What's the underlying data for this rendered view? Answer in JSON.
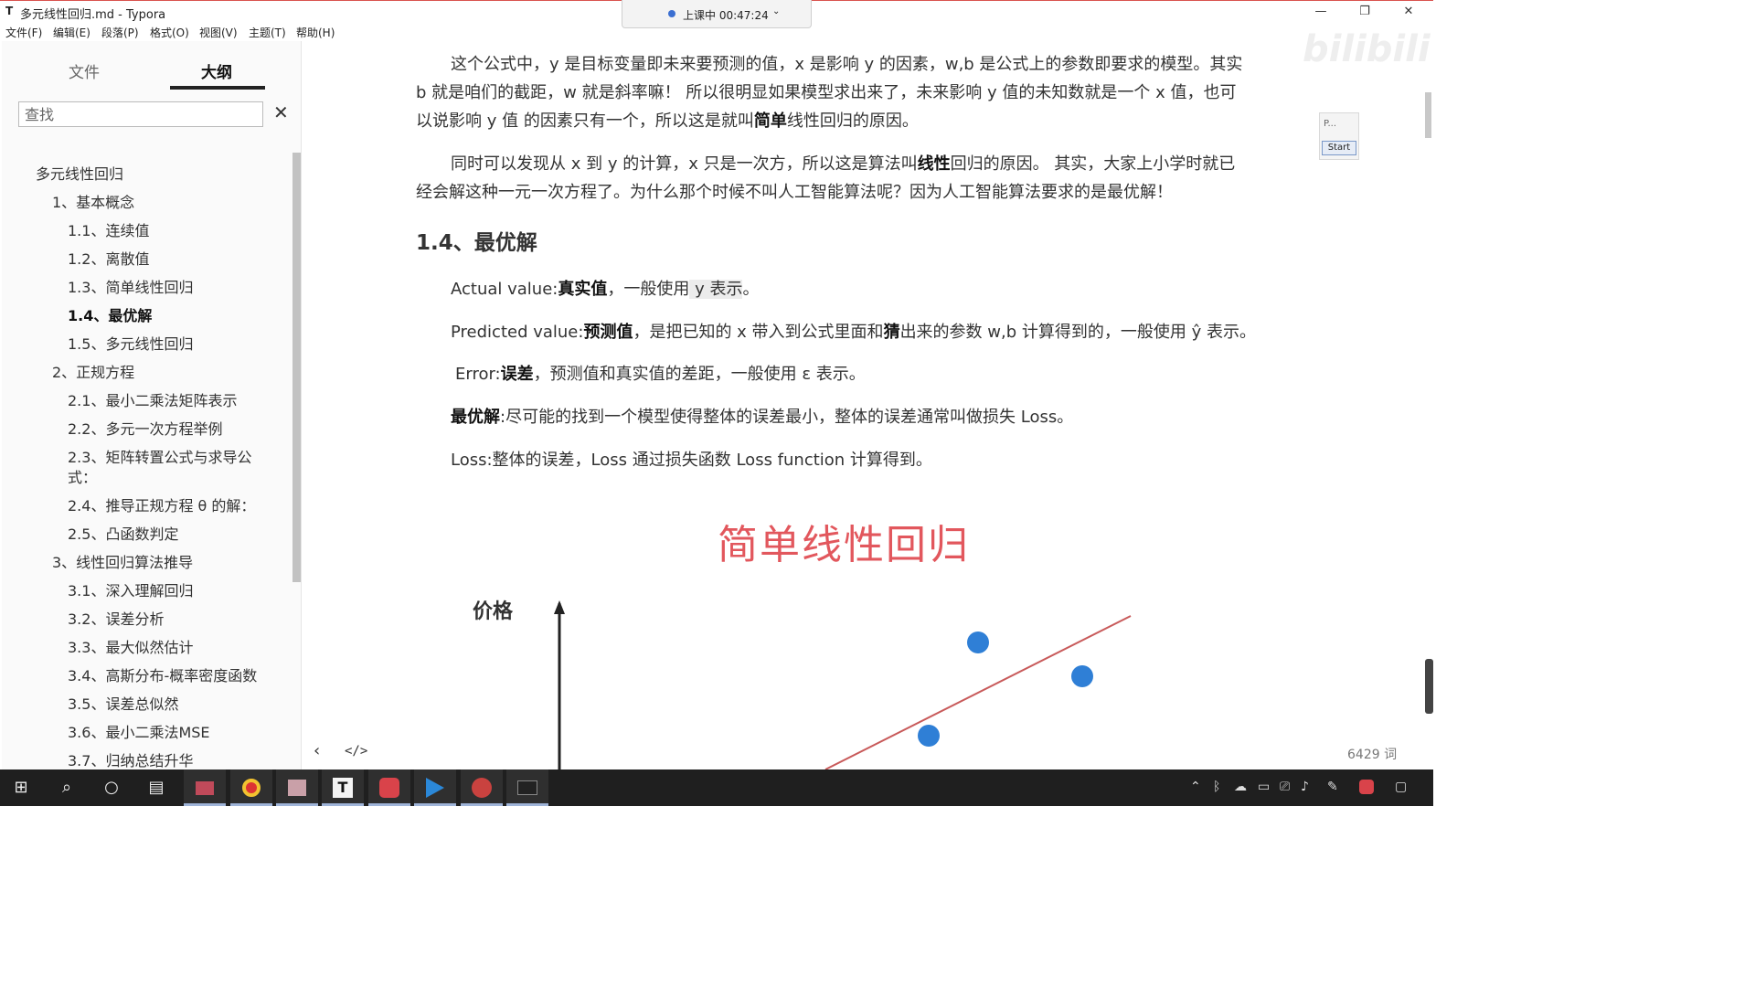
{
  "window": {
    "app_icon": "T",
    "title": "多元线性回归.md - Typora",
    "minimize": "—",
    "maximize": "❐",
    "close": "✕"
  },
  "recording": {
    "status": "上课中 00:47:24",
    "caret": "⌄"
  },
  "menubar": [
    "文件(F)",
    "编辑(E)",
    "段落(P)",
    "格式(O)",
    "视图(V)",
    "主题(T)",
    "帮助(H)"
  ],
  "sidebar": {
    "tab_files": "文件",
    "tab_outline": "大纲",
    "search_placeholder": "查找",
    "clear_icon": "✕",
    "outline": [
      "多元线性回归",
      "1、基本概念",
      "1.1、连续值",
      "1.2、离散值",
      "1.3、简单线性回归",
      "1.4、最优解",
      "1.5、多元线性回归",
      "2、正规方程",
      "2.1、最小二乘法矩阵表示",
      "2.2、多元一次方程举例",
      "2.3、矩阵转置公式与求导公",
      "式：",
      "2.4、推导正规方程 θ 的解：",
      "2.5、凸函数判定",
      "3、线性回归算法推导",
      "3.1、深入理解回归",
      "3.2、误差分析",
      "3.3、最大似然估计",
      "3.4、高斯分布-概率密度函数",
      "3.5、误差总似然",
      "3.6、最小二乘法MSE",
      "3.7、归纳总结升华"
    ]
  },
  "editor": {
    "p1": {
      "l1": "这个公式中，y 是目标变量即未来要预测的值，x 是影响 y 的因素，w,b 是公式上的参数即要求的模型。其实",
      "l2": "b 就是咱们的截距，w 就是斜率嘛！ 所以很明显如果模型求出来了，未来影响 y 值的未知数就是一个 x 值，也可",
      "l3a": "以说影响 y 值 的因素只有一个，所以这是就叫",
      "l3b": "简单",
      "l3c": "线性回归的原因。"
    },
    "p2": {
      "l1a": "同时可以发现从 x 到 y 的计算，x 只是一次方，所以这是算法叫",
      "l1b": "线性",
      "l1c": "回归的原因。 其实，大家上小学时就已",
      "l2": "经会解这种一元一次方程了。为什么那个时候不叫人工智能算法呢？因为人工智能算法要求的是最优解！"
    },
    "heading": "1.4、最优解",
    "actual": {
      "a": "Actual value:",
      "b": "真实值",
      "c": "，一般使用",
      "d": " y 表示",
      "e": "。"
    },
    "predicted": {
      "a": "Predicted value:",
      "b": "预测值",
      "c": "，是把已知的 x 带入到公式里面和",
      "d": "猜",
      "e": "出来的参数 w,b 计算得到的，一般使用 ŷ 表示。"
    },
    "error": {
      "a": "Error:",
      "b": "误差",
      "c": "，预测值和真实值的差距，一般使用 ε 表示。"
    },
    "optimal": {
      "a": "最优解",
      "b": ":尽可能的找到一个模型使得整体的误差最小，整体的误差通常叫做损失 Loss。"
    },
    "loss": "Loss:整体的误差，Loss 通过损失函数 Loss function 计算得到。",
    "word_count": "6429 词",
    "back_icon": "‹",
    "source_icon": "</>",
    "watermark": "bilibili",
    "pin_label": "P...",
    "start_button": "Start"
  },
  "figure": {
    "title": "简单线性回归",
    "ylabel": "价格",
    "colors": {
      "title": "#e2575d",
      "line": "#c85a5a",
      "point": "#2f7fd6",
      "axis": "#222222"
    }
  },
  "taskbar": {
    "apps": [
      "windows-start-icon",
      "search-icon",
      "cortana-icon",
      "task-view-icon",
      "file-explorer-icon",
      "chrome-icon",
      "snipping-icon",
      "typora-icon",
      "pdf-icon",
      "video-player-icon",
      "browser-icon",
      "terminal-icon"
    ],
    "tray": [
      "chevron-up-icon",
      "bluetooth-icon",
      "onedrive-icon",
      "battery-icon",
      "network-icon",
      "volume-icon",
      "pen-icon",
      "antivirus-icon",
      "notification-icon"
    ]
  }
}
